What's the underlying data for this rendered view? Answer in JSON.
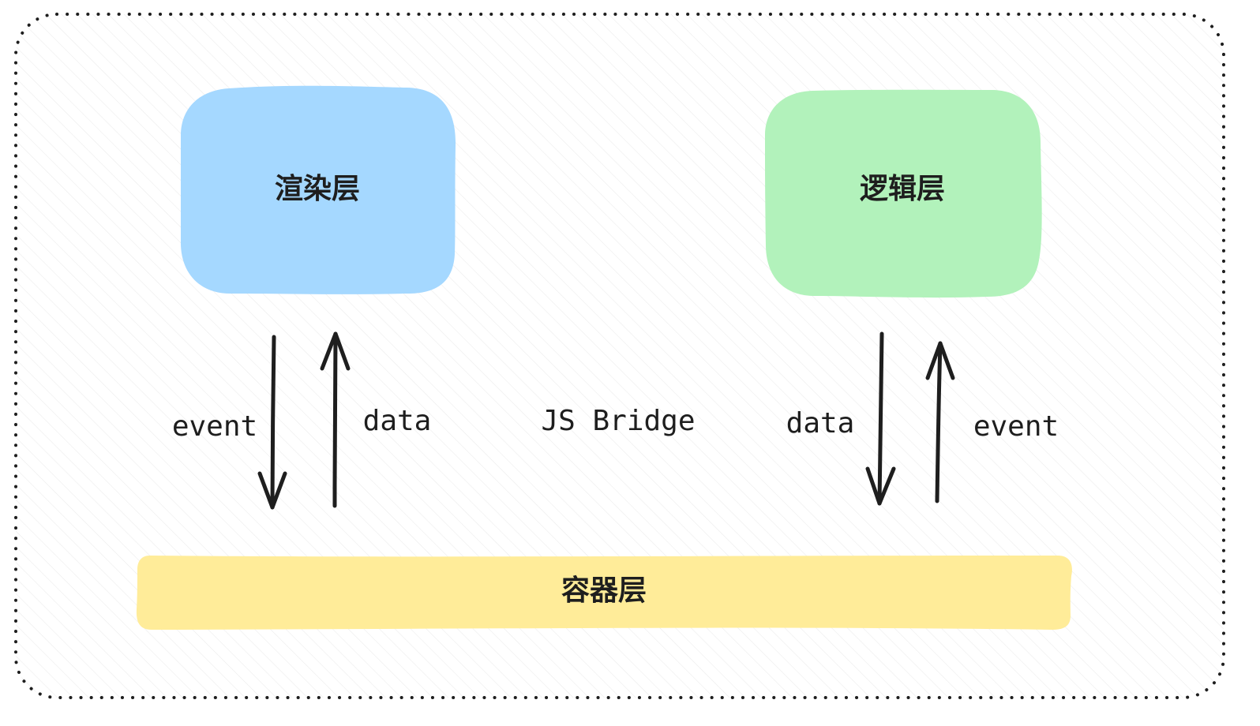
{
  "nodes": {
    "render_layer": {
      "label": "渲染层",
      "fill": "#a5d8ff"
    },
    "logic_layer": {
      "label": "逻辑层",
      "fill": "#b2f2bb"
    },
    "container_layer": {
      "label": "容器层",
      "fill": "#ffec99"
    }
  },
  "edges": {
    "left_event": {
      "label": "event",
      "direction": "down"
    },
    "left_data": {
      "label": "data",
      "direction": "up"
    },
    "right_data": {
      "label": "data",
      "direction": "down"
    },
    "right_event": {
      "label": "event",
      "direction": "up"
    }
  },
  "bridge": {
    "label": "JS Bridge"
  },
  "colors": {
    "stroke": "#1e1e1e",
    "frame_border": "#1e1e1e",
    "background": "#ffffff"
  }
}
